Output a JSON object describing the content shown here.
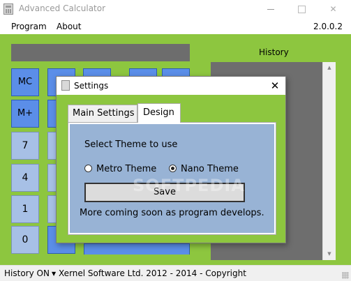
{
  "window": {
    "title": "Advanced Calculator",
    "controls": {
      "minimize": "minimize",
      "maximize": "maximize",
      "close": "✕"
    }
  },
  "menu": {
    "program": "Program",
    "about": "About",
    "version": "2.0.0.2"
  },
  "calculator": {
    "keys": {
      "mc": "MC",
      "m_plus": "M+",
      "k7": "7",
      "k4": "4",
      "k1": "1",
      "k0": "0"
    }
  },
  "history": {
    "label": "History"
  },
  "status": {
    "history_toggle": "History ON",
    "copyright": "Xernel Software Ltd. 2012 - 2014 -  Copyright"
  },
  "settings_dialog": {
    "title": "Settings",
    "close": "✕",
    "tabs": [
      {
        "label": "Main Settings",
        "active": false
      },
      {
        "label": "Design",
        "active": true
      }
    ],
    "design": {
      "heading": "Select Theme to use",
      "themes": [
        {
          "label": "Metro Theme",
          "selected": false
        },
        {
          "label": "Nano Theme",
          "selected": true
        }
      ],
      "save_label": "Save",
      "note": "More coming soon as program develops."
    }
  },
  "watermark": "SOFTPEDIA",
  "colors": {
    "app_background": "#8dc63f",
    "memory_key": "#5b8ee8",
    "number_key": "#a7c0e6",
    "history_panel": "#6e6e6e",
    "tab_page": "#98b3d5"
  }
}
